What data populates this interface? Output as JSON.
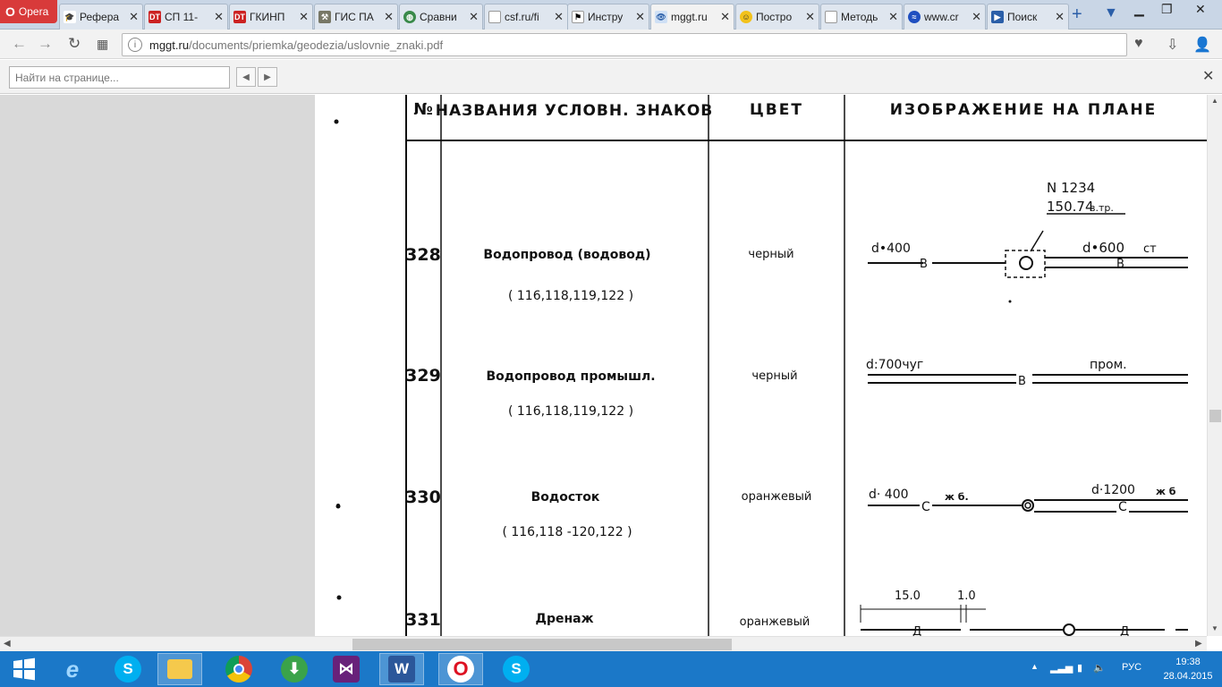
{
  "browser": {
    "menu_label": "Opera",
    "tabs": [
      {
        "title": "Рефера",
        "icon": "graduation-cap-icon",
        "active": false
      },
      {
        "title": "СП 11-",
        "icon": "dt-red-icon",
        "active": false
      },
      {
        "title": "ГКИНП",
        "icon": "dt-red-icon",
        "active": false
      },
      {
        "title": "ГИС ПА",
        "icon": "tools-icon",
        "active": false
      },
      {
        "title": "Сравни",
        "icon": "globe-icon",
        "active": false
      },
      {
        "title": "csf.ru/fi",
        "icon": "page-icon",
        "active": false
      },
      {
        "title": "Инстру",
        "icon": "tower-icon",
        "active": false
      },
      {
        "title": "mggt.ru",
        "icon": "eye-icon",
        "active": true
      },
      {
        "title": "Постро",
        "icon": "smiley-icon",
        "active": false
      },
      {
        "title": "Методь",
        "icon": "page-icon",
        "active": false
      },
      {
        "title": "www.cr",
        "icon": "globe-blue-icon",
        "active": false
      },
      {
        "title": "Поиск",
        "icon": "play-icon",
        "active": false
      }
    ],
    "new_tab_label": "+",
    "url_host": "mggt.ru",
    "url_path": "/documents/priemka/geodezia/uslovnie_znaki.pdf",
    "find_placeholder": "Найти на странице...",
    "find_prev": "◀",
    "find_next": "▶"
  },
  "document": {
    "headers": {
      "num": "№",
      "name": "НАЗВАНИЯ УСЛОВН. ЗНАКОВ",
      "color": "ЦВЕТ",
      "image": "ИЗОБРАЖЕНИЕ НА ПЛАНЕ"
    },
    "rows": [
      {
        "num": "328",
        "name": "Водопровод (водовод)",
        "refs": "( 116,118,119,122 )",
        "color": "черный",
        "labels": {
          "left_d": "d•400",
          "left_letter": "В",
          "right_d": "d•600",
          "right_mat": "ст",
          "right_letter": "В",
          "well_num": "N 1234",
          "well_level": "150.74",
          "well_suffix": "в.тр."
        }
      },
      {
        "num": "329",
        "name": "Водопровод промышл.",
        "refs": "( 116,118,119,122 )",
        "color": "черный",
        "labels": {
          "left_d": "d:700чуг",
          "mid_letter": "В",
          "right_word": "пром."
        }
      },
      {
        "num": "330",
        "name": "Водосток",
        "refs": "( 116,118 -120,122 )",
        "color": "оранжевый",
        "labels": {
          "left_d": "d· 400",
          "left_letter": "С",
          "left_mat": "ж б.",
          "right_d": "d·1200",
          "right_mat": "ж б",
          "right_letter": "С"
        }
      },
      {
        "num": "331",
        "name": "Дренаж",
        "refs": "",
        "color": "оранжевый",
        "labels": {
          "dim1": "15.0",
          "dim2": "1.0",
          "letter": "Д"
        }
      }
    ]
  },
  "taskbar": {
    "items": [
      {
        "name": "start-button",
        "glyph": "windows-icon"
      },
      {
        "name": "internet-explorer",
        "glyph": "e"
      },
      {
        "name": "skype",
        "glyph": "S"
      },
      {
        "name": "file-explorer",
        "glyph": "folder-icon"
      },
      {
        "name": "chrome",
        "glyph": "chrome-icon"
      },
      {
        "name": "downloader",
        "glyph": "download-icon"
      },
      {
        "name": "visual-studio",
        "glyph": "vs-icon"
      },
      {
        "name": "word",
        "glyph": "W"
      },
      {
        "name": "opera",
        "glyph": "O"
      },
      {
        "name": "skype-2",
        "glyph": "S"
      }
    ],
    "lang": "РУС",
    "time": "19:38",
    "date": "28.04.2015"
  }
}
